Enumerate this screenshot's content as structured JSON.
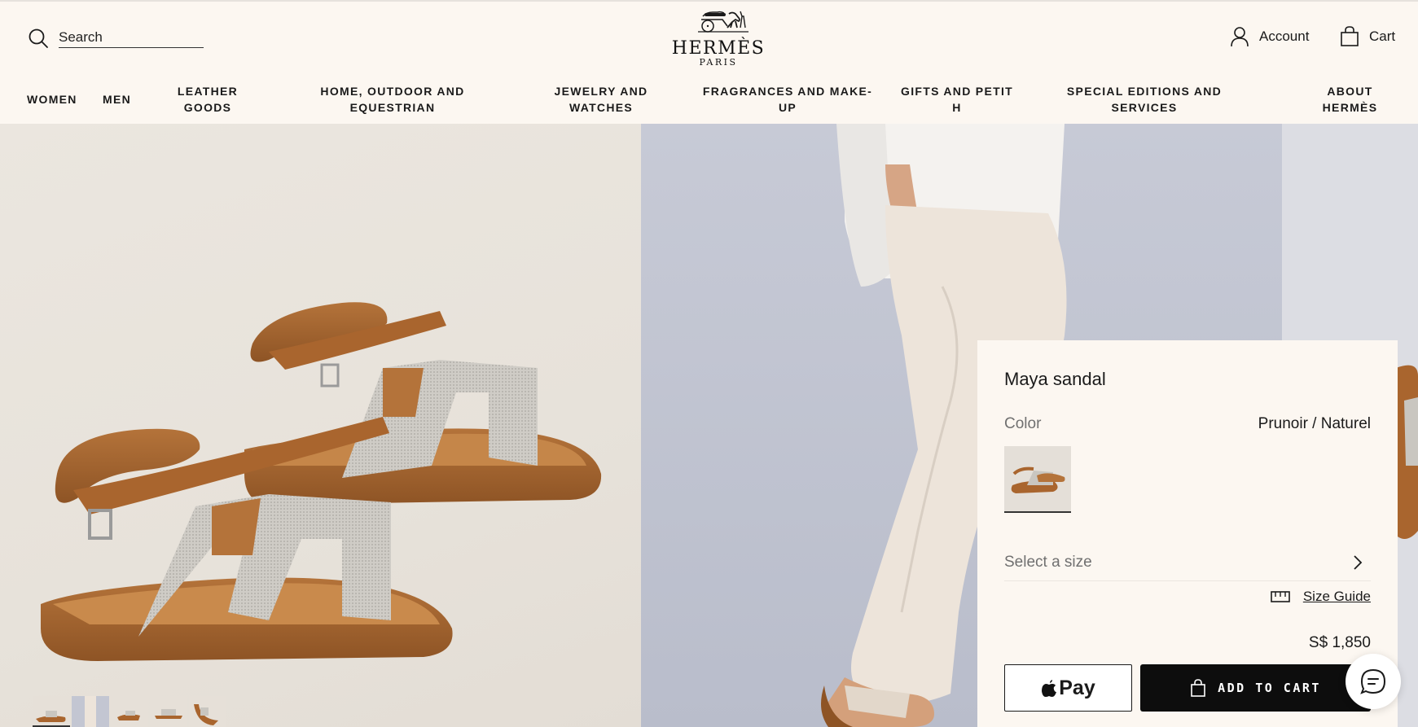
{
  "header": {
    "search_placeholder": "Search",
    "logo_text": "HERMÈS",
    "logo_sub": "PARIS",
    "account_label": "Account",
    "cart_label": "Cart"
  },
  "nav": [
    {
      "label": "WOMEN"
    },
    {
      "label": "MEN"
    },
    {
      "label": "LEATHER\nGOODS"
    },
    {
      "label": "HOME, OUTDOOR AND\nEQUESTRIAN"
    },
    {
      "label": "JEWELRY AND\nWATCHES"
    },
    {
      "label": "FRAGRANCES AND MAKE-\nUP"
    },
    {
      "label": "GIFTS AND PETIT\nH"
    },
    {
      "label": "SPECIAL EDITIONS AND\nSERVICES"
    },
    {
      "label": "ABOUT\nHERMÈS"
    }
  ],
  "product": {
    "name": "Maya sandal",
    "color_label": "Color",
    "color_value": "Prunoir / Naturel",
    "size_placeholder": "Select a size",
    "size_guide_label": "Size Guide",
    "price": "S$ 1,850",
    "apple_pay_label": "Pay",
    "add_to_cart_label": "ADD TO CART"
  },
  "gallery": {
    "thumbnail_count": 5,
    "active_thumbnail": 1
  },
  "icons": {
    "search": "search-icon",
    "account": "user-icon",
    "cart": "shopping-bag-icon",
    "chevron": "chevron-right-icon",
    "ruler": "ruler-icon",
    "apple": "apple-icon",
    "bag": "bag-icon",
    "chat": "chat-icon"
  },
  "colors": {
    "background": "#fcf7f1",
    "button_dark": "#0d0d0d",
    "leather": "#a8662f",
    "canvas": "#c9c6c0"
  }
}
